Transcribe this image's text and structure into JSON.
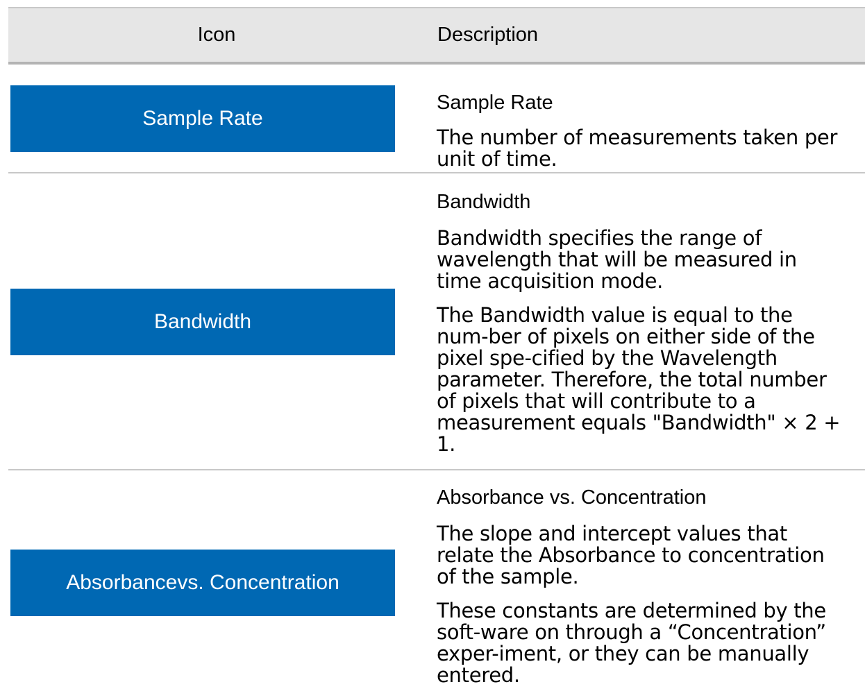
{
  "table": {
    "header": {
      "icon_col": "Icon",
      "description_col": "Description"
    },
    "rows": [
      {
        "button_label": "Sample Rate",
        "title": "Sample Rate",
        "paragraphs": [
          "The number of measurements taken per unit of time."
        ]
      },
      {
        "button_label": "Bandwidth",
        "title": "Bandwidth",
        "paragraphs": [
          "Bandwidth specifies the range of wavelength that will be measured in time acquisition mode.",
          "The Bandwidth value is equal to the num-ber of pixels on either side of the pixel spe-cified by the Wavelength parameter. Therefore, the total number of pixels that will contribute to a measurement equals \"Bandwidth\" × 2 + 1."
        ]
      },
      {
        "button_label": "Absorbancevs. Concentration",
        "title": "Absorbance vs. Concentration",
        "paragraphs": [
          "The slope and intercept values that relate the Absorbance to concentration of the sample.",
          "These constants are determined by the soft-ware on through a “Concentration” exper-iment, or they can be manually entered."
        ]
      }
    ]
  },
  "colors": {
    "button_bg": "#0068b3",
    "button_text": "#ffffff",
    "header_bg": "#e6e6e6",
    "divider": "#c8c8c8"
  }
}
